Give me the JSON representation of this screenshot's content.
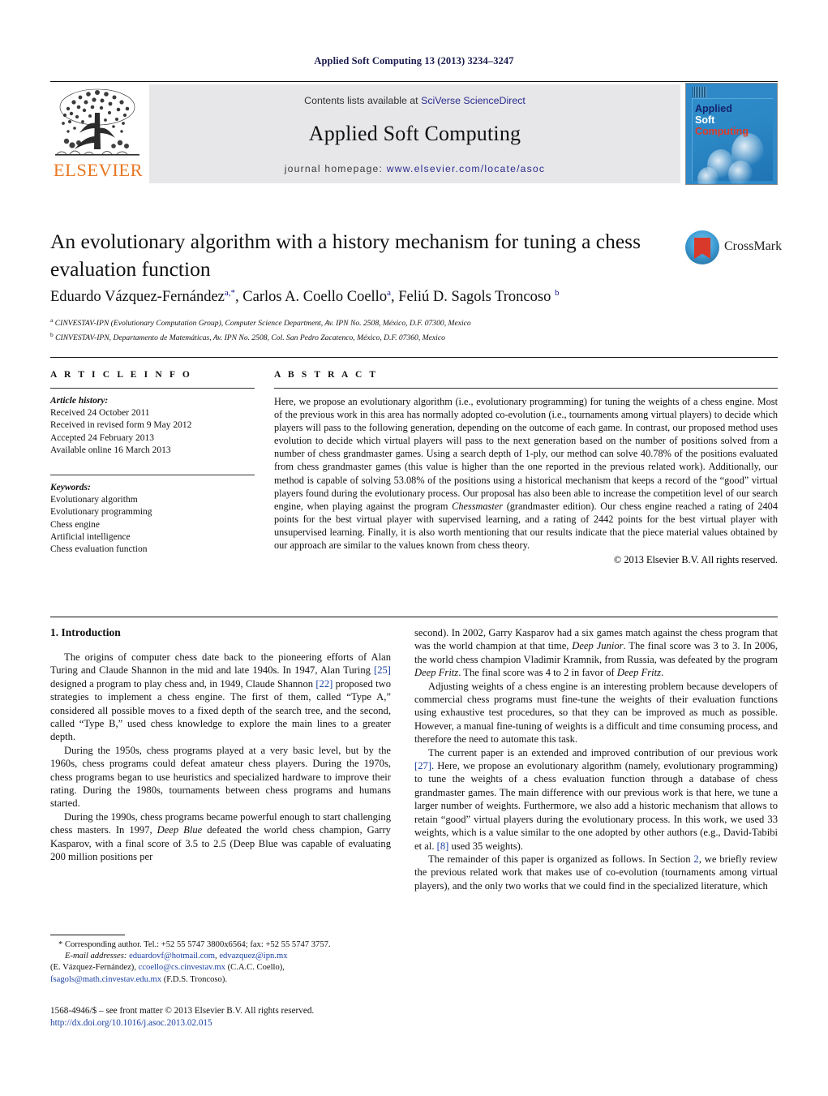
{
  "running_head": "Applied Soft Computing 13 (2013) 3234–3247",
  "masthead": {
    "contents_prefix": "Contents lists available at ",
    "contents_link": "SciVerse ScienceDirect",
    "journal_title": "Applied Soft Computing",
    "homepage_prefix": "journal homepage: ",
    "homepage_link": "www.elsevier.com/locate/asoc",
    "publisher_logo_text": "ELSEVIER",
    "cover_line1": "Applied",
    "cover_line2": "Soft",
    "cover_line3": "Computing"
  },
  "crossmark": {
    "label": "CrossMark"
  },
  "article": {
    "title": "An evolutionary algorithm with a history mechanism for tuning a chess evaluation function",
    "authors_html": "Eduardo Vázquez-Fernández<sup>a,*</sup>, Carlos A. Coello Coello<sup>a</sup>, Feliú D. Sagols Troncoso <sup>b</sup>",
    "affiliation_a": "CINVESTAV-IPN (Evolutionary Computation Group), Computer Science Department, Av. IPN No. 2508, México, D.F. 07300, Mexico",
    "affiliation_b": "CINVESTAV-IPN, Departamento de Matemáticas, Av. IPN No. 2508, Col. San Pedro Zacatenco, México, D.F. 07360, Mexico"
  },
  "info": {
    "heading": "A R T I C L E    I N F O",
    "history_label": "Article history:",
    "history": [
      "Received 24 October 2011",
      "Received in revised form 9 May 2012",
      "Accepted 24 February 2013",
      "Available online 16 March 2013"
    ],
    "keywords_label": "Keywords:",
    "keywords": [
      "Evolutionary algorithm",
      "Evolutionary programming",
      "Chess engine",
      "Artificial intelligence",
      "Chess evaluation function"
    ]
  },
  "abstract": {
    "heading": "A B S T R A C T",
    "part1": "Here, we propose an evolutionary algorithm (i.e., evolutionary programming) for tuning the weights of a chess engine. Most of the previous work in this area has normally adopted co-evolution (i.e., tournaments among virtual players) to decide which players will pass to the following generation, depending on the outcome of each game. In contrast, our proposed method uses evolution to decide which virtual players will pass to the next generation based on the number of positions solved from a number of chess grandmaster games. Using a search depth of 1-ply, our method can solve 40.78% of the positions evaluated from chess grandmaster games (this value is higher than the one reported in the previous related work). Additionally, our method is capable of solving 53.08% of the positions using a historical mechanism that keeps a record of the “good” virtual players found during the evolutionary process. Our proposal has also been able to increase the competition level of our search engine, when playing against the program ",
    "italic1": "Chessmaster",
    "part2": " (grandmaster edition). Our chess engine reached a rating of 2404 points for the best virtual player with supervised learning, and a rating of 2442 points for the best virtual player with unsupervised learning. Finally, it is also worth mentioning that our results indicate that the piece material values obtained by our approach are similar to the values known from chess theory.",
    "copyright": "© 2013 Elsevier B.V. All rights reserved."
  },
  "body": {
    "section1_heading": "1.  Introduction",
    "left": {
      "p1_a": "The origins of computer chess date back to the pioneering efforts of Alan Turing and Claude Shannon in the mid and late 1940s. In 1947, Alan Turing ",
      "p1_ref1": "[25]",
      "p1_b": " designed a program to play chess and, in 1949, Claude Shannon ",
      "p1_ref2": "[22]",
      "p1_c": " proposed two strategies to implement a chess engine. The first of them, called “Type A,” considered all possible moves to a fixed depth of the search tree, and the second, called “Type B,” used chess knowledge to explore the main lines to a greater depth.",
      "p2": "During the 1950s, chess programs played at a very basic level, but by the 1960s, chess programs could defeat amateur chess players. During the 1970s, chess programs began to use heuristics and specialized hardware to improve their rating. During the 1980s, tournaments between chess programs and humans started.",
      "p3_a": "During the 1990s, chess programs became powerful enough to start challenging chess masters. In 1997, ",
      "p3_it1": "Deep Blue",
      "p3_b": " defeated the world chess champion, Garry Kasparov, with a final score of 3.5 to 2.5 (Deep Blue was capable of evaluating 200 million positions per"
    },
    "right": {
      "p3_cont_a": "second). In 2002, Garry Kasparov had a six games match against the chess program that was the world champion at that time, ",
      "p3_cont_it1": "Deep Junior",
      "p3_cont_b": ". The final score was 3 to 3. In 2006, the world chess champion Vladimir Kramnik, from Russia, was defeated by the program ",
      "p3_cont_it2": "Deep Fritz",
      "p3_cont_c": ". The final score was 4 to 2 in favor of ",
      "p3_cont_it3": "Deep Fritz",
      "p3_cont_d": ".",
      "p4": "Adjusting weights of a chess engine is an interesting problem because developers of commercial chess programs must fine-tune the weights of their evaluation functions using exhaustive test procedures, so that they can be improved as much as possible. However, a manual fine-tuning of weights is a difficult and time consuming process, and therefore the need to automate this task.",
      "p5_a": "The current paper is an extended and improved contribution of our previous work ",
      "p5_ref1": "[27]",
      "p5_b": ". Here, we propose an evolutionary algorithm (namely, evolutionary programming) to tune the weights of a chess evaluation function through a database of chess grandmaster games. The main difference with our previous work is that here, we tune a larger number of weights. Furthermore, we also add a historic mechanism that allows to retain “good” virtual players during the evolutionary process. In this work, we used 33 weights, which is a value similar to the one adopted by other authors (e.g., David-Tabibi et al. ",
      "p5_ref2": "[8]",
      "p5_c": " used 35 weights).",
      "p6_a": "The remainder of this paper is organized as follows. In Section ",
      "p6_ref1": "2",
      "p6_b": ", we briefly review the previous related work that makes use of co-evolution (tournaments among virtual players), and the only two works that we could find in the specialized literature, which"
    }
  },
  "footnotes": {
    "corresponding_mark": "*",
    "corresponding": " Corresponding author. Tel.: +52 55 5747 3800x6564; fax: +52 55 5747 3757.",
    "email_label": "E-mail addresses:",
    "emails_line1_a": "eduardovf@hotmail.com",
    "emails_line1_b": "edvazquez@ipn.mx",
    "emails_line2_name": "(E. Vázquez-Fernández), ",
    "emails_line2_mail": "ccoello@cs.cinvestav.mx",
    "emails_line2_tail": " (C.A.C. Coello),",
    "emails_line3_mail": "fsagols@math.cinvestav.edu.mx",
    "emails_line3_tail": " (F.D.S. Troncoso).",
    "issn_line": "1568-4946/$ – see front matter © 2013 Elsevier B.V. All rights reserved.",
    "doi_line": "http://dx.doi.org/10.1016/j.asoc.2013.02.015"
  },
  "colors": {
    "link": "#1a3fa0",
    "masthead_link": "#2b2b8f",
    "elsevier_orange": "#E87722",
    "cover_blue": "#2f89c8",
    "runhead": "#1a1a4e"
  }
}
